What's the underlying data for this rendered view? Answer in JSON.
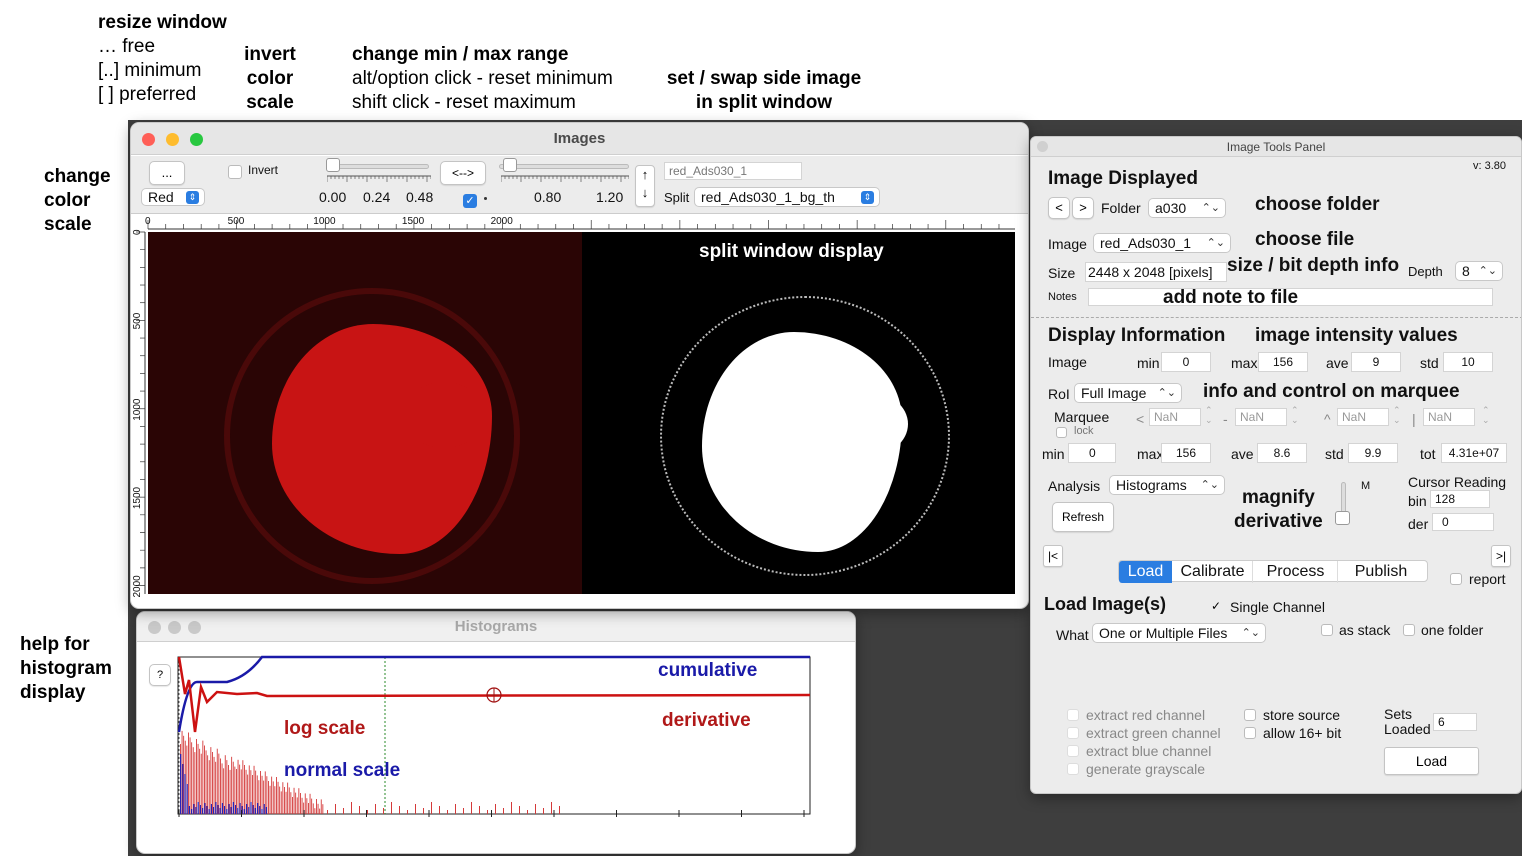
{
  "annotations": {
    "resize": [
      "resize window",
      "… free",
      "[..] minimum",
      "[  ] preferred"
    ],
    "invert": [
      "invert",
      "color",
      "scale"
    ],
    "range": [
      "change min / max range",
      "alt/option click - reset minimum",
      "shift click - reset maximum"
    ],
    "split": [
      "set / swap side image",
      "in split window"
    ],
    "color": [
      "change",
      "color",
      "scale"
    ],
    "help": [
      "help for",
      "histogram",
      "display"
    ]
  },
  "images_window": {
    "title": "Images",
    "more_button": "...",
    "color_select": "Red",
    "invert_label": "Invert",
    "left_ticks": [
      "0.00",
      "0.24",
      "0.48"
    ],
    "swap_button": "<-->",
    "right_ticks": [
      "0.80",
      "1.20"
    ],
    "main_image_name": "red_Ads030_1",
    "split_label": "Split",
    "split_select": "red_Ads030_1_bg_th",
    "x_axis": [
      "0",
      "500",
      "1000",
      "1500",
      "2000"
    ],
    "y_axis": [
      "0",
      "500",
      "1000",
      "1500",
      "2000"
    ],
    "split_overlay": "split window display"
  },
  "histogram_window": {
    "title": "Histograms",
    "help_button": "?",
    "cumulative": "cumulative",
    "derivative": "derivative",
    "log_scale": "log scale",
    "normal_scale": "normal scale"
  },
  "panel": {
    "title": "Image Tools Panel",
    "version": "v: 3.80",
    "image_displayed": "Image Displayed",
    "prev": "<",
    "next": ">",
    "folder_label": "Folder",
    "folder_value": "a030",
    "choose_folder": "choose folder",
    "image_label": "Image",
    "image_value": "red_Ads030_1",
    "choose_file": "choose file",
    "size_label": "Size",
    "size_value": "2448 x 2048 [pixels]",
    "size_note": "size / bit depth info",
    "depth_label": "Depth",
    "depth_value": "8",
    "notes_label": "Notes",
    "notes_overlay": "add note to file",
    "display_info": "Display Information",
    "intensity_note": "image intensity values",
    "img_row_label": "Image",
    "min_label": "min",
    "min_value": "0",
    "max_label": "max",
    "max_value": "156",
    "ave_label": "ave",
    "ave_value": "9",
    "std_label": "std",
    "std_value": "10",
    "roi_label": "RoI",
    "roi_value": "Full Image",
    "marquee_note": "info and control on marquee",
    "marquee_label": "Marquee",
    "lock_label": "lock",
    "nan": "NaN",
    "lt": "<",
    "dash": "-",
    "caret": "^",
    "bar": "|",
    "m_min_label": "min",
    "m_min_value": "0",
    "m_max_label": "max",
    "m_max_value": "156",
    "m_ave_label": "ave",
    "m_ave_value": "8.6",
    "m_std_label": "std",
    "m_std_value": "9.9",
    "m_tot_label": "tot",
    "m_tot_value": "4.31e+07",
    "analysis_label": "Analysis",
    "analysis_value": "Histograms",
    "magnify_note": [
      "magnify",
      "derivative"
    ],
    "m_label": "M",
    "cursor_reading": "Cursor Reading",
    "bin_label": "bin",
    "bin_value": "128",
    "der_label": "der",
    "der_value": "0",
    "refresh": "Refresh",
    "first": "|<",
    "last": ">|",
    "tabs": [
      "Load",
      "Calibrate",
      "Process",
      "Publish"
    ],
    "report_label": "report",
    "load_images": "Load Image(s)",
    "single_channel": "Single Channel",
    "what_label": "What",
    "what_value": "One or Multiple Files",
    "as_stack": "as stack",
    "one_folder": "one folder",
    "extract_red": "extract red channel",
    "extract_green": "extract green channel",
    "extract_blue": "extract blue channel",
    "grayscale": "generate grayscale",
    "store_source": "store source",
    "allow16": "allow 16+ bit",
    "sets_loaded": [
      "Sets",
      "Loaded"
    ],
    "sets_value": "6",
    "load_button": "Load"
  },
  "colors": {
    "red": "#cc1111",
    "blue": "#1a1aa8",
    "tab_active": "#2a7de1"
  }
}
